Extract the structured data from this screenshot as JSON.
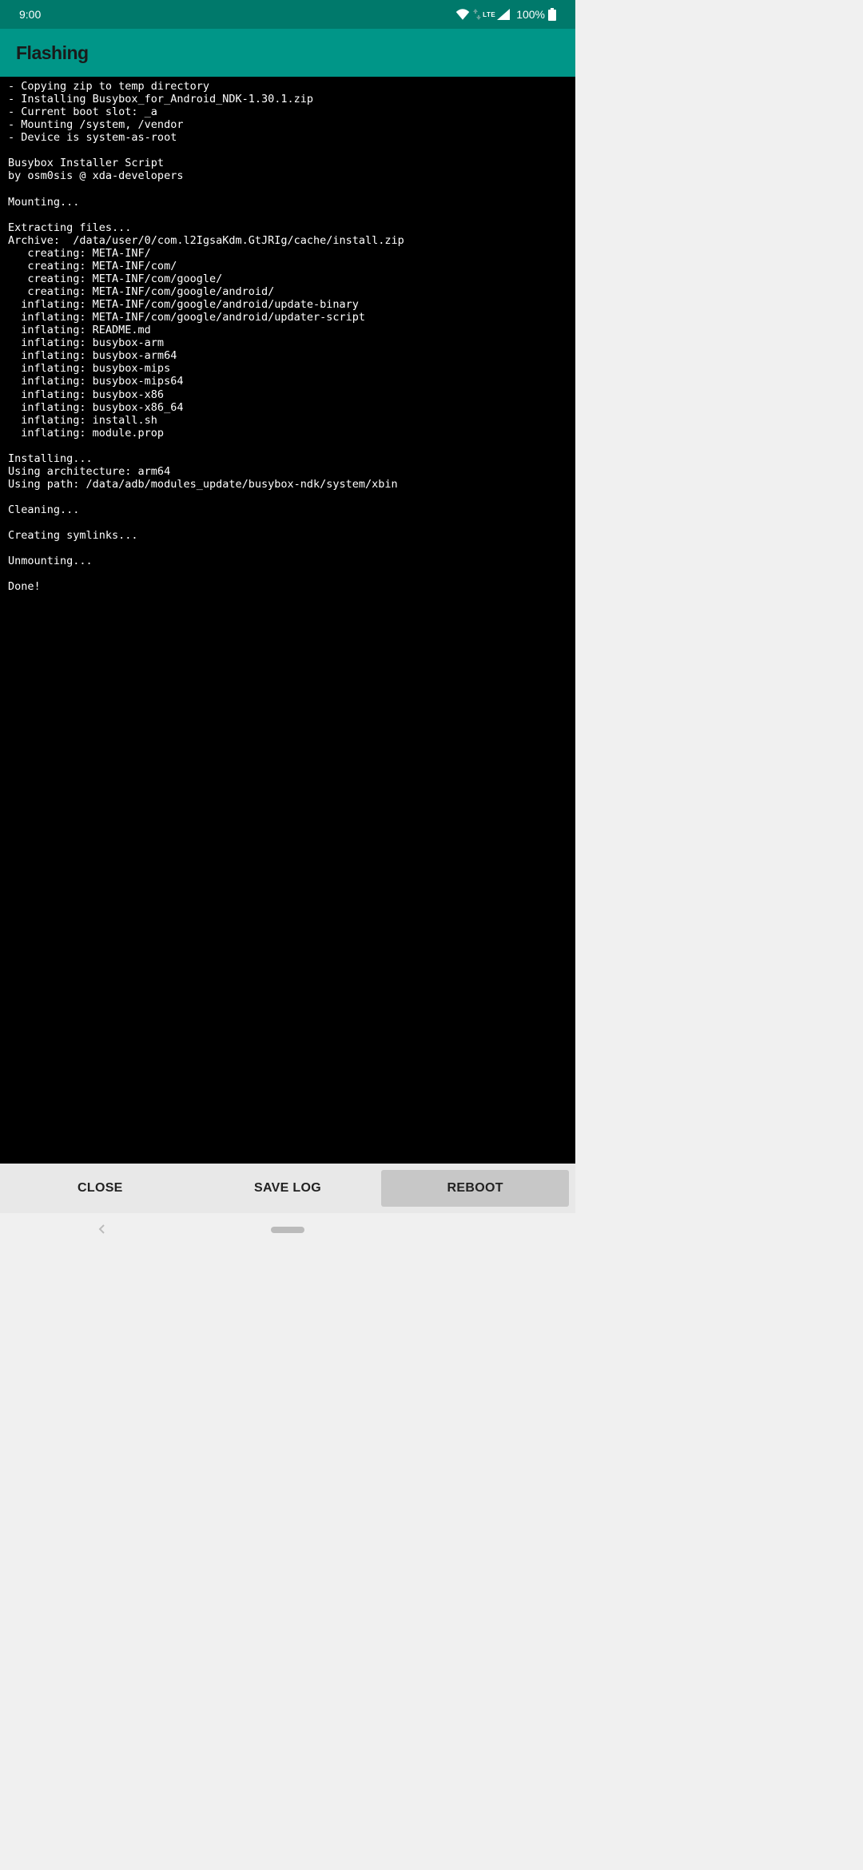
{
  "status": {
    "time": "9:00",
    "lte": "LTE",
    "battery": "100%"
  },
  "header": {
    "title": "Flashing"
  },
  "terminal": {
    "text": "- Copying zip to temp directory\n- Installing Busybox_for_Android_NDK-1.30.1.zip\n- Current boot slot: _a\n- Mounting /system, /vendor\n- Device is system-as-root\n\nBusybox Installer Script\nby osm0sis @ xda-developers\n\nMounting...\n\nExtracting files...\nArchive:  /data/user/0/com.l2IgsaKdm.GtJRIg/cache/install.zip\n   creating: META-INF/\n   creating: META-INF/com/\n   creating: META-INF/com/google/\n   creating: META-INF/com/google/android/\n  inflating: META-INF/com/google/android/update-binary\n  inflating: META-INF/com/google/android/updater-script\n  inflating: README.md\n  inflating: busybox-arm\n  inflating: busybox-arm64\n  inflating: busybox-mips\n  inflating: busybox-mips64\n  inflating: busybox-x86\n  inflating: busybox-x86_64\n  inflating: install.sh\n  inflating: module.prop\n\nInstalling...\nUsing architecture: arm64\nUsing path: /data/adb/modules_update/busybox-ndk/system/xbin\n\nCleaning...\n\nCreating symlinks...\n\nUnmounting...\n\nDone!"
  },
  "buttons": {
    "close": "CLOSE",
    "save_log": "SAVE LOG",
    "reboot": "REBOOT"
  }
}
